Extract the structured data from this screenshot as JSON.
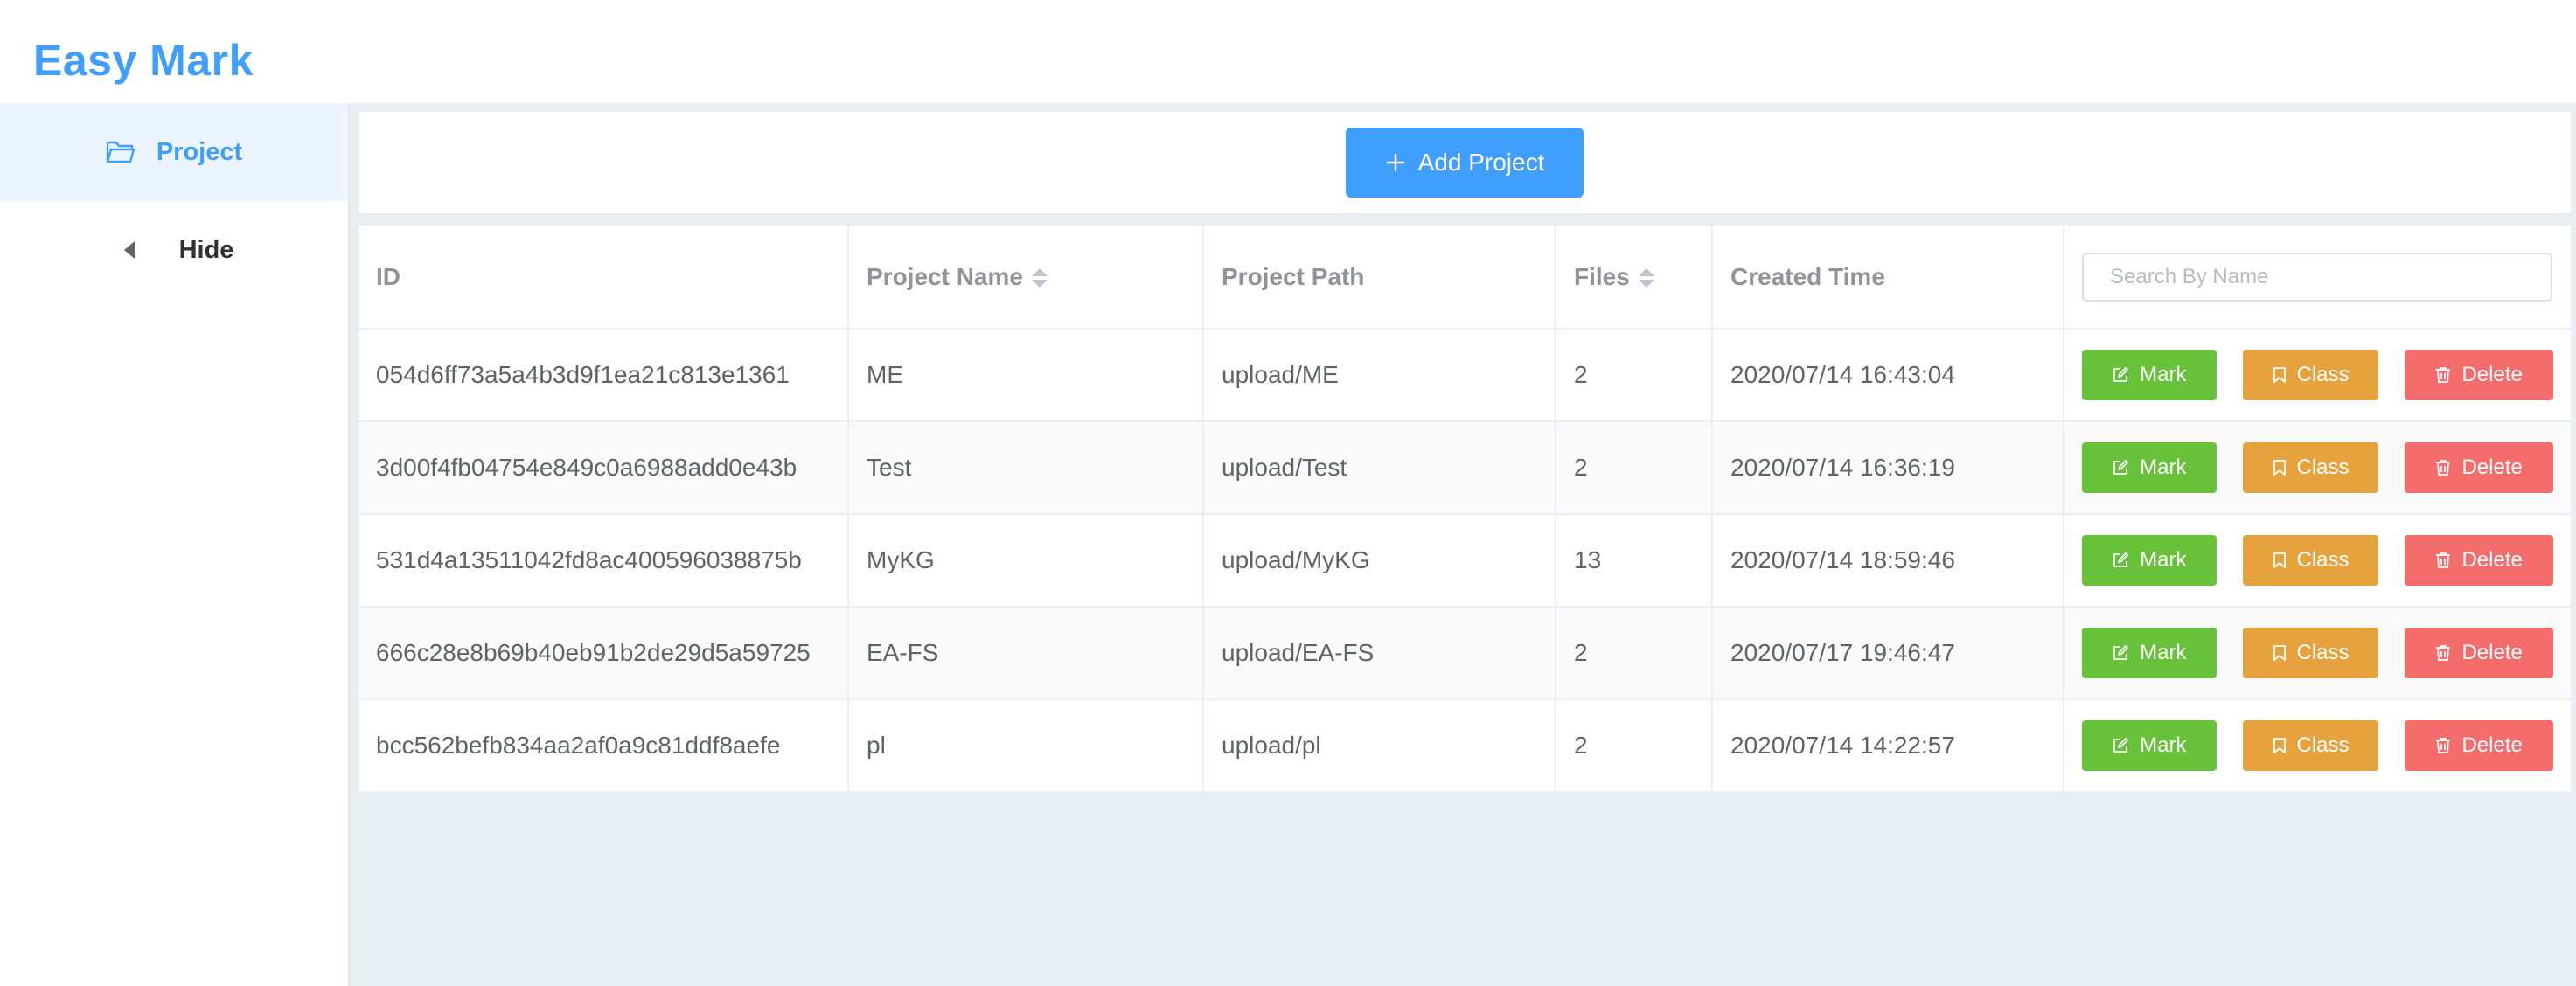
{
  "app": {
    "title": "Easy Mark"
  },
  "sidebar": {
    "items": [
      {
        "label": "Project",
        "icon": "folder-open-icon"
      },
      {
        "label": "Hide",
        "icon": "caret-left-icon"
      }
    ]
  },
  "toolbar": {
    "add_label": "Add Project",
    "add_icon": "plus-icon"
  },
  "table": {
    "columns": [
      "ID",
      "Project Name",
      "Project Path",
      "Files",
      "Created Time"
    ],
    "search_placeholder": "Search By Name",
    "rows": [
      {
        "id": "054d6ff73a5a4b3d9f1ea21c813e1361",
        "name": "ME",
        "path": "upload/ME",
        "files": "2",
        "created": "2020/07/14 16:43:04"
      },
      {
        "id": "3d00f4fb04754e849c0a6988add0e43b",
        "name": "Test",
        "path": "upload/Test",
        "files": "2",
        "created": "2020/07/14 16:36:19"
      },
      {
        "id": "531d4a13511042fd8ac400596038875b",
        "name": "MyKG",
        "path": "upload/MyKG",
        "files": "13",
        "created": "2020/07/14 18:59:46"
      },
      {
        "id": "666c28e8b69b40eb91b2de29d5a59725",
        "name": "EA-FS",
        "path": "upload/EA-FS",
        "files": "2",
        "created": "2020/07/17 19:46:47"
      },
      {
        "id": "bcc562befb834aa2af0a9c81ddf8aefe",
        "name": "pl",
        "path": "upload/pl",
        "files": "2",
        "created": "2020/07/14 14:22:57"
      }
    ],
    "actions": {
      "mark": "Mark",
      "class": "Class",
      "delete": "Delete"
    }
  },
  "colors": {
    "primary": "#409eff",
    "success": "#67c23a",
    "warning": "#e6a23c",
    "danger": "#f56c6c",
    "main_bg": "#e9eef3"
  }
}
